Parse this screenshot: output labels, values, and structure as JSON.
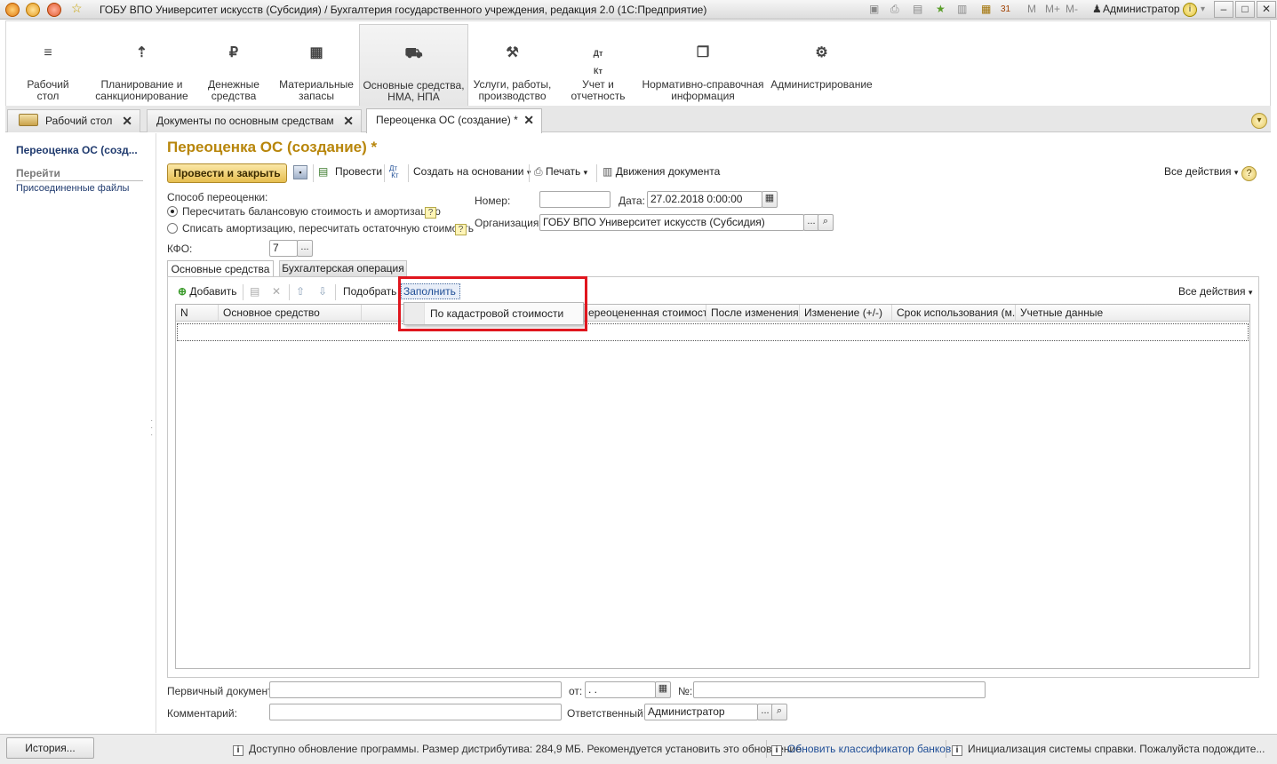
{
  "window": {
    "title": "ГОБУ ВПО Университет искусств (Субсидия) / Бухгалтерия государственного учреждения, редакция 2.0  (1С:Предприятие)",
    "toolbar_m": "M",
    "toolbar_mplus": "M+",
    "toolbar_mminus": "M-",
    "user": "Администратор",
    "calendar_day": "31"
  },
  "sections": [
    {
      "label": "Рабочий\nстол",
      "icon": "menu-icon"
    },
    {
      "label": "Планирование и\nсанкционирование",
      "icon": "planning-icon"
    },
    {
      "label": "Денежные\nсредства",
      "icon": "money-icon"
    },
    {
      "label": "Материальные\nзапасы",
      "icon": "inventory-icon"
    },
    {
      "label": "Основные средства,\nНМА, НПА",
      "icon": "truck-icon"
    },
    {
      "label": "Услуги, работы,\nпроизводство",
      "icon": "tools-icon"
    },
    {
      "label": "Учет и\nотчетность",
      "icon": "accounting-icon"
    },
    {
      "label": "Нормативно-справочная\nинформация",
      "icon": "reference-icon"
    },
    {
      "label": "Администрирование",
      "icon": "gear-icon"
    }
  ],
  "open_tabs": [
    {
      "label": "Рабочий стол"
    },
    {
      "label": "Документы по основным средствам"
    },
    {
      "label": "Переоценка ОС (создание) *"
    }
  ],
  "leftnav": {
    "current": "Переоценка ОС (созд...",
    "goto_header": "Перейти",
    "files_link": "Присоединенные файлы"
  },
  "form": {
    "title": "Переоценка ОС (создание) *",
    "toolbar": {
      "post_close": "Провести и закрыть",
      "post": "Провести",
      "create_based": "Создать на основании",
      "print": "Печать",
      "movements": "Движения документа",
      "all_actions": "Все действия"
    },
    "method_label": "Способ переоценки:",
    "method_option1": "Пересчитать балансовую стоимость и амортизацию",
    "method_option2": "Списать амортизацию, пересчитать остаточную стоимость",
    "kfo_label": "КФО:",
    "kfo_value": "7",
    "number_label": "Номер:",
    "number_value": "",
    "date_label": "Дата:",
    "date_value": "27.02.2018  0:00:00",
    "org_label": "Организация:",
    "org_value": "ГОБУ ВПО Университет искусств (Субсидия)",
    "tabs": {
      "assets": "Основные средства",
      "accounting": "Бухгалтерская операция"
    },
    "table_toolbar": {
      "add": "Добавить",
      "pick": "Подобрать",
      "fill": "Заполнить",
      "all_actions": "Все действия"
    },
    "dropdown": {
      "item": "По кадастровой стоимости"
    },
    "columns": [
      "N",
      "Основное средство",
      "",
      "ереоцененная стоимость",
      "После изменения",
      "Изменение (+/-)",
      "Срок использования (м...",
      "Учетные данные"
    ],
    "primary_doc_label": "Первичный документ:",
    "primary_doc_value": "",
    "from_label": "от:",
    "from_value": " .  .",
    "num_label": "№:",
    "num_value": "",
    "comment_label": "Комментарий:",
    "comment_value": "",
    "responsible_label": "Ответственный:",
    "responsible_value": "Администратор"
  },
  "statusbar": {
    "history": "История...",
    "msg1": "Доступно обновление программы. Размер дистрибутива: 284,9 МБ. Рекомендуется установить это обновление.",
    "msg2": "Обновить классификатор банков",
    "msg3": "Инициализация системы справки. Пожалуйста подождите..."
  },
  "colors": {
    "title_accent": "#b8860b",
    "highlight_box": "#e0161e",
    "link": "#1f4e96"
  }
}
